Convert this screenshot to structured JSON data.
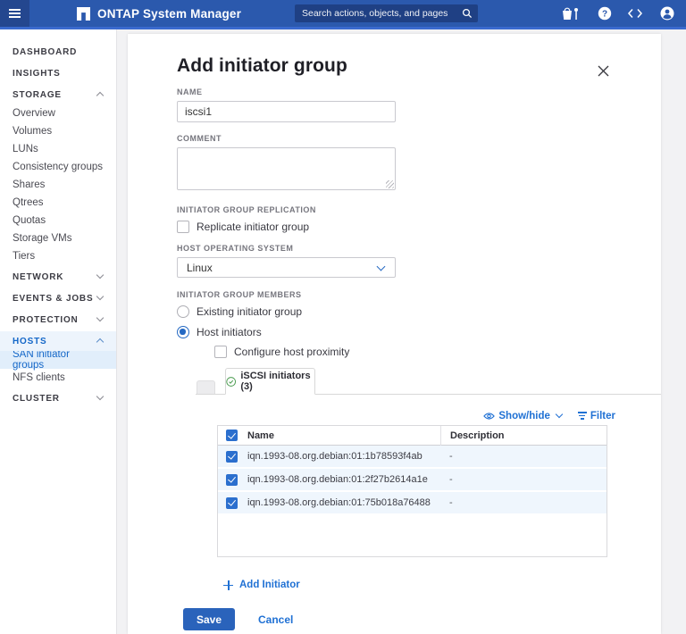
{
  "colors": {
    "header_blue": "#2b59ad",
    "header_dark_blue": "#24478f",
    "search_field_blue": "#1f4084",
    "accent_line_blue": "#3a6ace",
    "accent_blue": "#2569c3",
    "link_blue": "#2071d4",
    "selected_row_blue": "#eff6fd",
    "sidebar_highlight_blue": "#e1eefb",
    "success_green": "#4e9d53"
  },
  "header": {
    "app_title": "ONTAP System Manager",
    "search_placeholder": "Search actions, objects, and pages"
  },
  "sidebar": {
    "dashboard": "DASHBOARD",
    "insights": "INSIGHTS",
    "storage": {
      "label": "STORAGE",
      "items": [
        "Overview",
        "Volumes",
        "LUNs",
        "Consistency groups",
        "Shares",
        "Qtrees",
        "Quotas",
        "Storage VMs",
        "Tiers"
      ]
    },
    "network": "NETWORK",
    "events_jobs": "EVENTS & JOBS",
    "protection": "PROTECTION",
    "hosts": {
      "label": "HOSTS",
      "items": [
        "SAN initiator groups",
        "NFS clients"
      ]
    },
    "cluster": "CLUSTER"
  },
  "dialog": {
    "title": "Add initiator group",
    "fields": {
      "name_label": "NAME",
      "name_value": "iscsi1",
      "comment_label": "COMMENT",
      "replication_label": "INITIATOR GROUP REPLICATION",
      "replicate_checkbox_label": "Replicate initiator group",
      "host_os_label": "HOST OPERATING SYSTEM",
      "host_os_value": "Linux",
      "members_label": "INITIATOR GROUP MEMBERS",
      "existing_group_radio_label": "Existing initiator group",
      "host_initiators_radio_label": "Host initiators",
      "proximity_checkbox_label": "Configure host proximity"
    },
    "initiators_tab": {
      "label": "iSCSI initiators (3)"
    },
    "table_controls": {
      "show_hide_label": "Show/hide",
      "filter_label": "Filter"
    },
    "table": {
      "columns": [
        "Name",
        "Description"
      ],
      "rows": [
        {
          "name": "iqn.1993-08.org.debian:01:1b78593f4ab",
          "description": "-"
        },
        {
          "name": "iqn.1993-08.org.debian:01:2f27b2614a1e",
          "description": "-"
        },
        {
          "name": "iqn.1993-08.org.debian:01:75b018a76488",
          "description": "-"
        }
      ]
    },
    "add_initiator_label": "Add Initiator",
    "save_label": "Save",
    "cancel_label": "Cancel"
  }
}
